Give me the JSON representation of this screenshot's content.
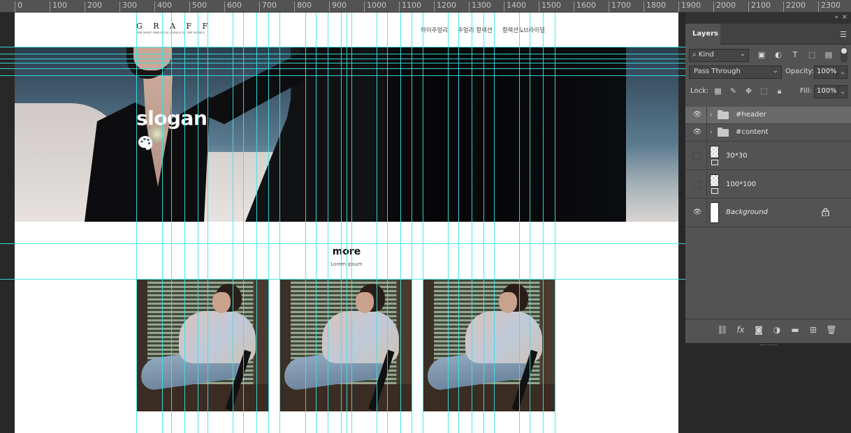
{
  "ruler": {
    "ticks": [
      "0",
      "100",
      "200",
      "300",
      "400",
      "500",
      "600",
      "700",
      "800",
      "900",
      "1000",
      "1100",
      "1200",
      "1300",
      "1400",
      "1500",
      "1600",
      "1700",
      "1800",
      "1900",
      "2000",
      "2100",
      "2200",
      "2300"
    ]
  },
  "document": {
    "logo_main": "G R A F F",
    "logo_sub": "THE MOST FABULOUS JEWELS IN THE WORLD",
    "nav": [
      "하이주얼리",
      "주얼리 컬렉션",
      "컬렉션&브라이덜"
    ],
    "slogan": "slogan",
    "palette_icon": "palette-icon",
    "more_title": "more",
    "more_sub": "Lorem ipsum"
  },
  "panel": {
    "tab": "Layers",
    "kind": "Kind",
    "blend_mode": "Pass Through",
    "opacity_label": "Opacity:",
    "opacity_value": "100%",
    "lock_label": "Lock:",
    "fill_label": "Fill:",
    "fill_value": "100%",
    "filter_icons": [
      "image-filter-icon",
      "adjustment-filter-icon",
      "type-filter-icon",
      "shape-filter-icon",
      "smart-object-filter-icon"
    ],
    "lock_icons": [
      "lock-pixels-icon",
      "lock-image-icon",
      "lock-position-icon",
      "lock-artboard-icon",
      "lock-all-icon"
    ],
    "layers": [
      {
        "name": "#header",
        "type": "group",
        "visible": true,
        "selected": true
      },
      {
        "name": "#content",
        "type": "group",
        "visible": true,
        "selected": false
      },
      {
        "name": "30*30",
        "type": "smart",
        "visible": false,
        "selected": false
      },
      {
        "name": "100*100",
        "type": "smart",
        "visible": false,
        "selected": false
      },
      {
        "name": "Background",
        "type": "background",
        "visible": true,
        "locked": true
      }
    ],
    "bottom_icons": [
      "link-layers-icon",
      "fx-icon",
      "add-mask-icon",
      "adjustment-layer-icon",
      "new-group-icon",
      "new-layer-icon",
      "delete-layer-icon"
    ]
  },
  "colors": {
    "guide": "#39e6e6",
    "panel_bg": "#535353",
    "workspace_bg": "#282828"
  }
}
